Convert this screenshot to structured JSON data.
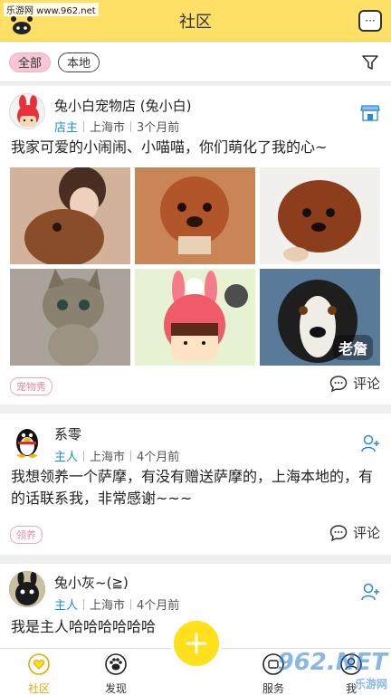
{
  "watermark_top": "乐游网 www.962.net",
  "header": {
    "title": "社区"
  },
  "filters": {
    "all": "全部",
    "local": "本地"
  },
  "posts": [
    {
      "name": "兔小白宠物店 (兔小白)",
      "role": "店主",
      "city": "上海市",
      "time": "3个月前",
      "content": "我家可爱的小闹闹、小喵喵，你们萌化了我的心~",
      "photo_label": "老詹",
      "tag": "宠物秀",
      "comment": "评论",
      "action_icon": "shop-icon"
    },
    {
      "name": "系零",
      "role": "主人",
      "city": "上海市",
      "time": "4个月前",
      "content": "我想领养一个萨摩，有没有赠送萨摩的，上海本地的，有的话联系我，非常感谢~~~",
      "tag": "领养",
      "comment": "评论",
      "action_icon": "add-friend-icon"
    },
    {
      "name": "兔小灰~(≧)",
      "role": "主人",
      "city": "上海市",
      "time": "4个月前",
      "content": "我是主人哈哈哈哈哈哈",
      "action_icon": "add-friend-icon"
    }
  ],
  "tabbar": {
    "community": "社区",
    "discover": "发现",
    "service": "服务",
    "mine": "我"
  },
  "watermark_bottom": {
    "logo": "962.NET",
    "sub": "乐游网"
  },
  "colors": {
    "header": "#ffe066",
    "accent": "#ffe01a",
    "role": "#1a8fd0",
    "tag": "#e58aa3"
  }
}
